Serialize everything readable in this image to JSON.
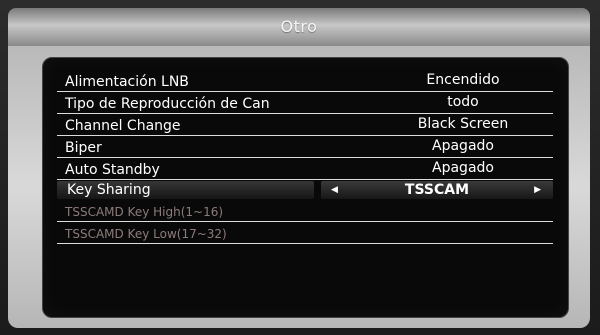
{
  "window": {
    "title": "Otro"
  },
  "settings": [
    {
      "label": "Alimentación LNB",
      "value": "Encendido"
    },
    {
      "label": "Tipo de Reproducción de Can",
      "value": "todo"
    },
    {
      "label": "Channel Change",
      "value": "Black Screen"
    },
    {
      "label": "Biper",
      "value": "Apagado"
    },
    {
      "label": "Auto Standby",
      "value": "Apagado"
    },
    {
      "label": "Key Sharing",
      "value": "TSSCAM"
    },
    {
      "label": "TSSCAMD Key High(1~16)",
      "value": ""
    },
    {
      "label": "TSSCAMD Key Low(17~32)",
      "value": ""
    }
  ],
  "selected_arrows": {
    "left": "◀",
    "right": "▶"
  }
}
